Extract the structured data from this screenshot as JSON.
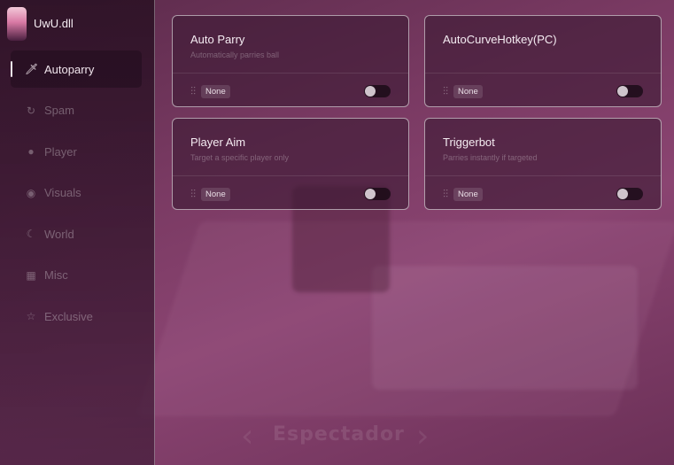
{
  "app": {
    "title": "UwU.dll"
  },
  "sidebar": {
    "items": [
      {
        "label": "Autoparry",
        "icon": "sword-icon",
        "active": true
      },
      {
        "label": "Spam",
        "icon": "refresh-icon",
        "active": false
      },
      {
        "label": "Player",
        "icon": "user-icon",
        "active": false
      },
      {
        "label": "Visuals",
        "icon": "eye-icon",
        "active": false
      },
      {
        "label": "World",
        "icon": "moon-icon",
        "active": false
      },
      {
        "label": "Misc",
        "icon": "grid-icon",
        "active": false
      },
      {
        "label": "Exclusive",
        "icon": "star-icon",
        "active": false
      }
    ]
  },
  "cards": [
    {
      "title": "Auto Parry",
      "description": "Automatically parries ball",
      "keybind": "None",
      "enabled": false
    },
    {
      "title": "AutoCurveHotkey(PC)",
      "description": "",
      "keybind": "None",
      "enabled": false
    },
    {
      "title": "Player Aim",
      "description": "Target a specific player only",
      "keybind": "None",
      "enabled": false
    },
    {
      "title": "Triggerbot",
      "description": "Parries instantly if targeted",
      "keybind": "None",
      "enabled": false
    }
  ],
  "background": {
    "watermark": "Espectador"
  },
  "colors": {
    "accent": "#f0e4ec",
    "panel": "#3c1a34",
    "backdrop": "#7a3a63"
  }
}
